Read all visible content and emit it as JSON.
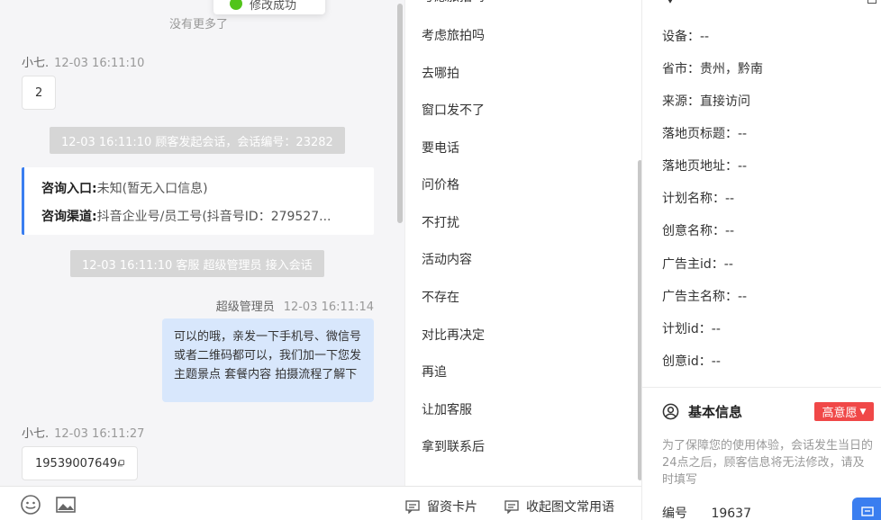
{
  "toast": {
    "text": "修改成功"
  },
  "chat": {
    "no_more": "没有更多了",
    "messages": [
      {
        "name": "小七.",
        "time": "12-03 16:11:10",
        "text": "2"
      },
      {
        "system": "12-03 16:11:10 顾客发起会话，会话编号：23282"
      },
      {
        "card": {
          "entry_label": "咨询入口:",
          "entry_value": "未知(暂无入口信息)",
          "channel_label": "咨询渠道:",
          "channel_value": "抖音企业号/员工号(抖音号ID：279527..."
        }
      },
      {
        "system": "12-03 16:11:10 客服 超级管理员 接入会话"
      },
      {
        "name": "超级管理员",
        "time": "12-03 16:11:14",
        "text": "可以的哦，亲发一下手机号、微信号或者二维码都可以，我们加一下您发主题景点 套餐内容 拍摄流程了解下"
      },
      {
        "name": "小七.",
        "time": "12-03 16:11:27",
        "text": "19539007649"
      }
    ]
  },
  "toolbar": {
    "emoji_icon": "smile-icon",
    "image_icon": "image-icon",
    "card_label": "留资卡片",
    "common_label": "收起图文常用语"
  },
  "quick_replies": [
    "考虑旅拍吗",
    "去哪拍",
    "窗口发不了",
    "要电话",
    "问价格",
    "不打扰",
    "活动内容",
    "不存在",
    "对比再决定",
    "再追",
    "让加客服",
    "拿到联系后"
  ],
  "source_info": {
    "fields": [
      {
        "label": "设备：",
        "value": "--"
      },
      {
        "label": "省市：",
        "value": "贵州，黔南"
      },
      {
        "label": "来源：",
        "value": "直接访问"
      },
      {
        "label": "落地页标题：",
        "value": "--"
      },
      {
        "label": "落地页地址：",
        "value": "--"
      },
      {
        "label": "计划名称：",
        "value": "--"
      },
      {
        "label": "创意名称：",
        "value": "--"
      },
      {
        "label": "广告主id：",
        "value": "--"
      },
      {
        "label": "广告主名称：",
        "value": "--"
      },
      {
        "label": "计划id：",
        "value": "--"
      },
      {
        "label": "创意id：",
        "value": "--"
      }
    ]
  },
  "basic_info": {
    "title": "基本信息",
    "badge": "高意愿",
    "notice": "为了保障您的使用体验，会话发生当日的24点之后，顾客信息将无法修改，请及时填写",
    "id_label": "编号",
    "id_value": "19637"
  },
  "colors": {
    "accent": "#3a7ef0",
    "badge": "#f04848",
    "bubble": "#d8e7fc"
  }
}
